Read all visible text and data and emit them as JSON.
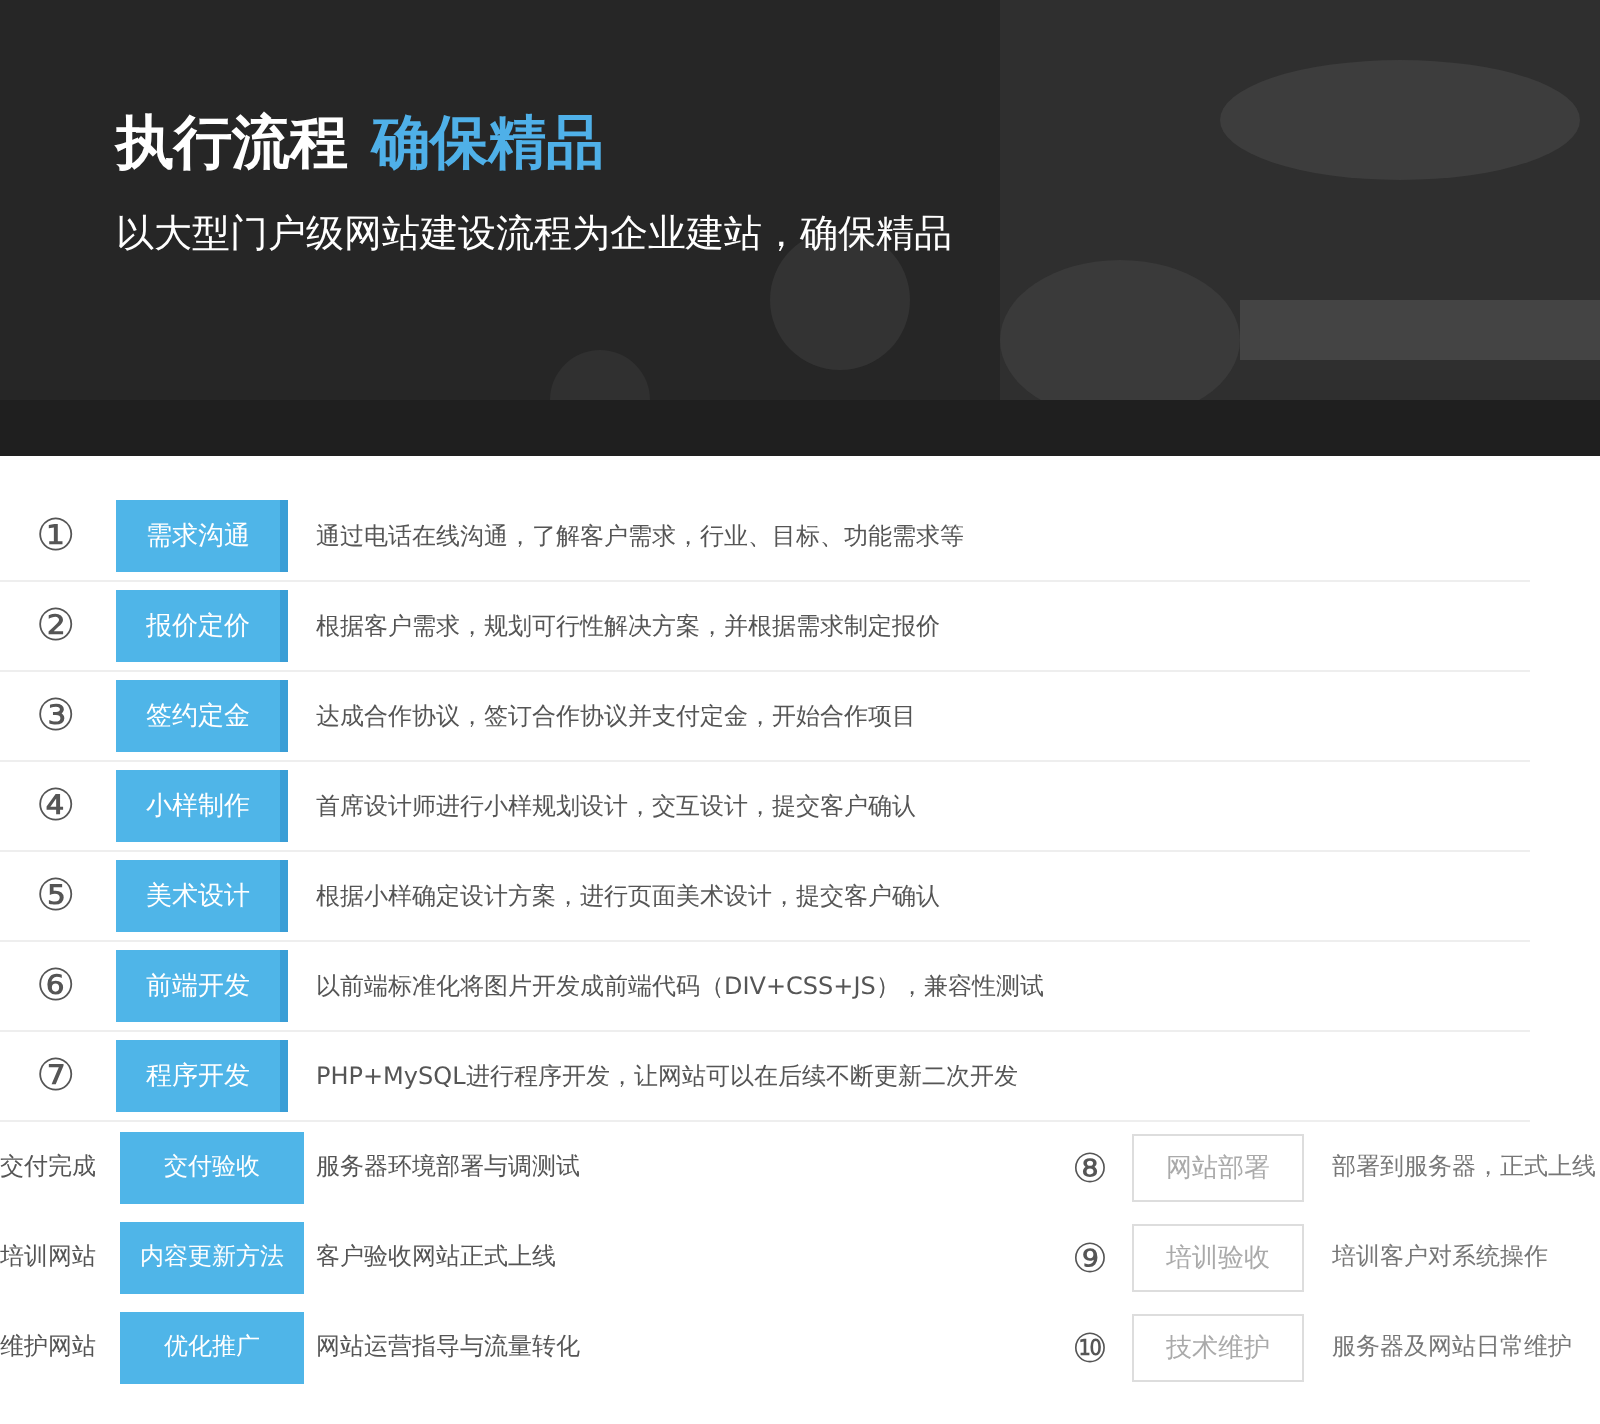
{
  "banner": {
    "kind": "picture",
    "title": "执行流程",
    "title_highlight": "确保精品",
    "subtitle": "以大型门户级网站建设流程为企业建站，确保精品"
  },
  "steps": [
    {
      "kind": "full",
      "number": "①",
      "label": "需求沟通",
      "text": "通过电话在线沟通，了解客户需求，行业、目标、功能需求等"
    },
    {
      "kind": "full",
      "number": "②",
      "label": "报价定价",
      "text": "根据客户需求，规划可行性解决方案，并根据需求制定报价"
    },
    {
      "kind": "full",
      "number": "③",
      "label": "签约定金",
      "text": "达成合作协议，签订合作协议并支付定金，开始合作项目"
    },
    {
      "kind": "full",
      "number": "④",
      "label": "小样制作",
      "text": "首席设计师进行小样规划设计，交互设计，提交客户确认"
    },
    {
      "kind": "full",
      "number": "⑤",
      "label": "美术设计",
      "text": "根据小样确定设计方案，进行页面美术设计，提交客户确认"
    },
    {
      "kind": "full",
      "number": "⑥",
      "label": "前端开发",
      "text": "以前端标准化将图片开发成前端代码（DIV+CSS+JS），兼容性测试"
    },
    {
      "kind": "full",
      "number": "⑦",
      "label": "程序开发",
      "text": "PHP+MySQL进行程序开发，让网站可以在后续不断更新二次开发"
    },
    {
      "kind": "split",
      "lead": "交付完成",
      "label": "交付验收",
      "text": "服务器环境部署与调测试",
      "number": "⑧",
      "box_label": "网站部署",
      "tail": "部署到服务器，正式上线"
    },
    {
      "kind": "split",
      "lead": "培训网站",
      "label": "内容更新方法",
      "text": "客户验收网站正式上线",
      "number": "⑨",
      "box_label": "培训验收",
      "tail": "培训客户对系统操作"
    },
    {
      "kind": "split",
      "lead": "维护网站",
      "label": "优化推广",
      "text": "网站运营指导与流量转化",
      "number": "⑩",
      "box_label": "技术维护",
      "tail": "服务器及网站日常维护"
    }
  ]
}
